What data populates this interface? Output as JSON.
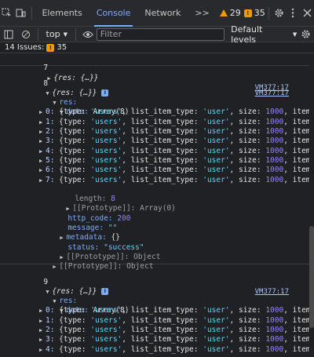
{
  "toolbar": {
    "tabs": [
      "Elements",
      "Console",
      "Network"
    ],
    "more_tabs": ">>",
    "warning_count": "29",
    "issue_count": "35"
  },
  "filterbar": {
    "context": "top",
    "filter_placeholder": "Filter",
    "levels": "Default levels"
  },
  "issues": {
    "label": "14 Issues:",
    "count": "35"
  },
  "console": {
    "msg7": {
      "index": "7",
      "summary": "{res: {…}}",
      "source": "VM377:17"
    },
    "msg8": {
      "index": "8",
      "summary": "{res: {…}}",
      "source": "VM377:17",
      "res_label": "res:",
      "data_label": "data:",
      "data_type": "Array(8)",
      "items": [
        "0",
        "1",
        "2",
        "3",
        "4",
        "5",
        "6",
        "7"
      ],
      "item_prefix": "{type: ",
      "item_type": "'users'",
      "item_mid": ", list_item_type: ",
      "item_lit": "'user'",
      "item_size_label": ", size: ",
      "item_size": "1000",
      "item_suffix": ", items:",
      "length_label": "length:",
      "length_value": "8",
      "proto_array": "[[Prototype]]: Array(0)",
      "http_code_label": "http_code:",
      "http_code_value": "200",
      "message_label": "message:",
      "message_value": "\"\"",
      "metadata_label": "metadata:",
      "metadata_value": "{}",
      "status_label": "status:",
      "status_value": "\"success\"",
      "proto_obj_inner": "[[Prototype]]: Object",
      "proto_obj_outer": "[[Prototype]]: Object"
    },
    "msg9": {
      "index": "9",
      "summary": "{res: {…}}",
      "source": "VM377:17",
      "res_label": "res:",
      "data_label": "data:",
      "data_type": "Array(8)",
      "items": [
        "0",
        "1",
        "2",
        "3",
        "4"
      ]
    }
  },
  "colors": {
    "accent": "#7cacf8",
    "warning": "#f29900",
    "background": "#202124"
  }
}
